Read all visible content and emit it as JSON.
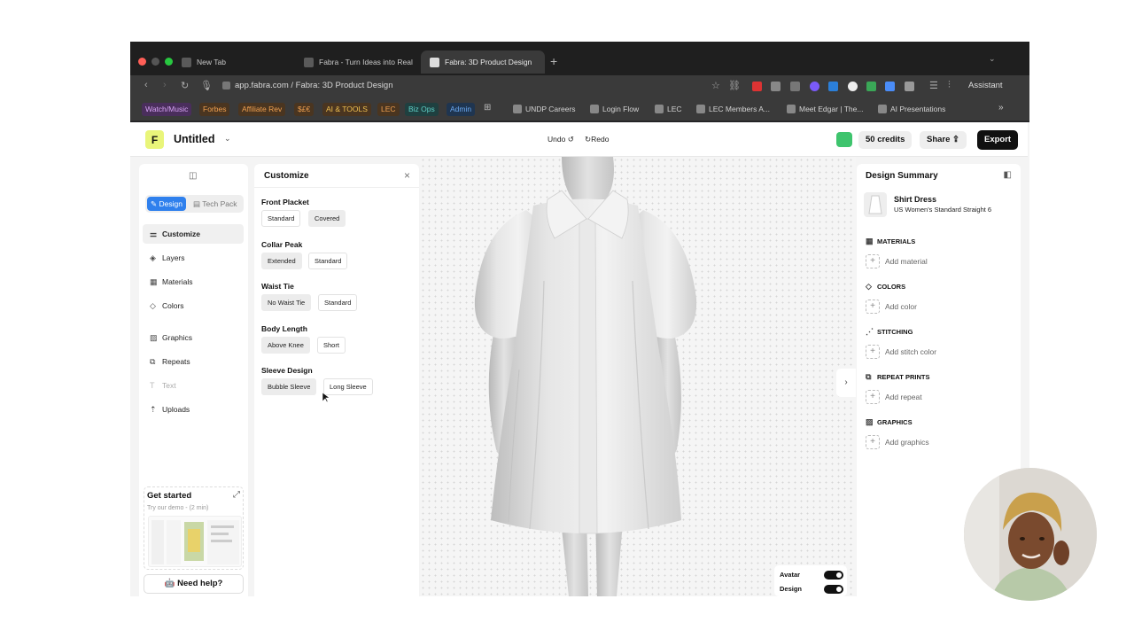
{
  "browser": {
    "tabs": [
      {
        "label": "New Tab"
      },
      {
        "label": "Fabra - Turn Ideas into Real"
      },
      {
        "label": "Fabra: 3D Product Design"
      }
    ],
    "url": "app.fabra.com / Fabra: 3D Product Design",
    "assistant_label": "Assistant",
    "bookmarks": [
      {
        "label": "Watch/Music",
        "color": "#8e44c8"
      },
      {
        "label": "Forbes",
        "color": "#d9822b"
      },
      {
        "label": "Affiliate Rev",
        "color": "#d9822b"
      },
      {
        "label": "$£€",
        "color": "#d9822b"
      },
      {
        "label": "AI & TOOLS",
        "color": "#d9822b"
      },
      {
        "label": "LEC",
        "color": "#d9822b"
      },
      {
        "label": "Biz Ops",
        "color": "#2bb3b1"
      },
      {
        "label": "Admin",
        "color": "#2b7fd9"
      },
      {
        "label": "UNDP Careers"
      },
      {
        "label": "Login Flow"
      },
      {
        "label": "LEC"
      },
      {
        "label": "LEC Members A..."
      },
      {
        "label": "Meet Edgar | The..."
      },
      {
        "label": "AI Presentations"
      }
    ]
  },
  "header": {
    "title": "Untitled",
    "undo": "Undo",
    "redo": "Redo",
    "credits": "50 credits",
    "share": "Share",
    "export": "Export"
  },
  "sidebar": {
    "mode_tabs": [
      "Design",
      "Tech Pack"
    ],
    "items": [
      {
        "label": "Customize",
        "icon": "sliders-icon"
      },
      {
        "label": "Layers",
        "icon": "layers-icon"
      },
      {
        "label": "Materials",
        "icon": "materials-icon"
      },
      {
        "label": "Colors",
        "icon": "paint-bucket-icon"
      },
      {
        "label": "Graphics",
        "icon": "image-icon"
      },
      {
        "label": "Repeats",
        "icon": "repeat-icon"
      },
      {
        "label": "Text",
        "icon": "text-icon"
      },
      {
        "label": "Uploads",
        "icon": "upload-icon"
      }
    ],
    "get_started": {
      "title": "Get started",
      "subtitle": "Try our demo - (2 min)"
    },
    "help": "Need help?"
  },
  "customize": {
    "title": "Customize",
    "groups": [
      {
        "label": "Front Placket",
        "options": [
          "Standard",
          "Covered"
        ],
        "selected": 1
      },
      {
        "label": "Collar Peak",
        "options": [
          "Extended",
          "Standard"
        ],
        "selected": 0
      },
      {
        "label": "Waist Tie",
        "options": [
          "No Waist Tie",
          "Standard"
        ],
        "selected": 0
      },
      {
        "label": "Body Length",
        "options": [
          "Above Knee",
          "Short"
        ],
        "selected": 0
      },
      {
        "label": "Sleeve Design",
        "options": [
          "Bubble Sleeve",
          "Long Sleeve"
        ],
        "selected": 0
      }
    ]
  },
  "viewer": {
    "toggles": [
      {
        "label": "Avatar",
        "on": true
      },
      {
        "label": "Design",
        "on": true
      }
    ]
  },
  "summary": {
    "title": "Design Summary",
    "product_name": "Shirt Dress",
    "product_size": "US Women's Standard Straight 6",
    "sections": [
      {
        "label": "MATERIALS",
        "add": "Add material"
      },
      {
        "label": "COLORS",
        "add": "Add color"
      },
      {
        "label": "STITCHING",
        "add": "Add stitch color"
      },
      {
        "label": "REPEAT PRINTS",
        "add": "Add repeat"
      },
      {
        "label": "GRAPHICS",
        "add": "Add graphics"
      }
    ]
  }
}
